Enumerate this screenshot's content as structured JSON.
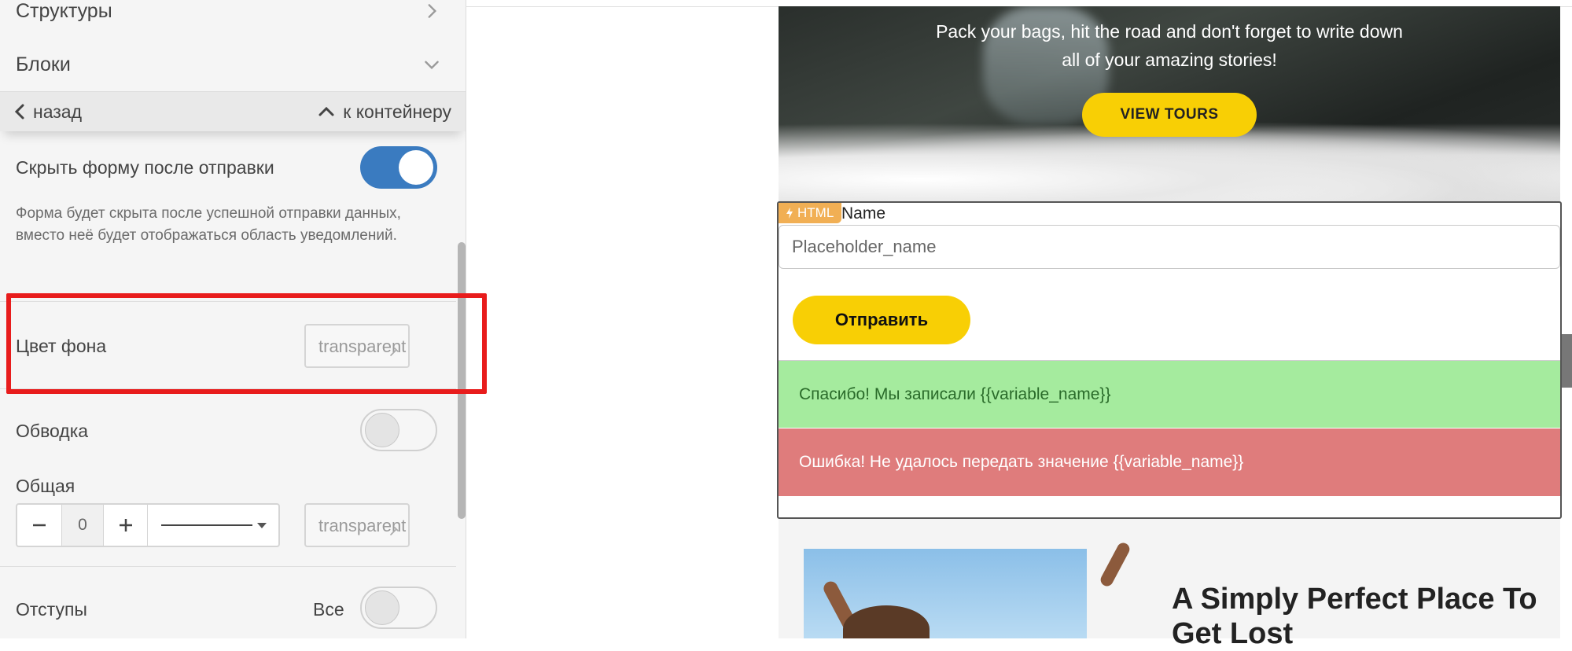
{
  "sidebar": {
    "structures_label": "Структуры",
    "blocks_label": "Блоки",
    "back_label": "назад",
    "container_label": "к контейнеру",
    "hide_form": {
      "label": "Скрыть форму после отправки",
      "enabled": true,
      "hint": "Форма будет скрыта после успешной отправки данных, вместо неё будет отображаться область уведомлений."
    },
    "bg_color": {
      "label": "Цвет фона",
      "value": "transparent"
    },
    "border": {
      "label": "Обводка",
      "enabled": false
    },
    "general": {
      "label": "Общая",
      "width_value": "0",
      "color_value": "transparent"
    },
    "padding": {
      "label": "Отступы",
      "all_label": "Все",
      "enabled": false
    }
  },
  "preview": {
    "hero_text": "Pack your bags, hit the road and don't forget to write down all of your amazing stories!",
    "hero_button": "VIEW TOURS",
    "html_badge": "HTML",
    "field_label": "Name",
    "field_placeholder": "Placeholder_name",
    "submit_label": "Отправить",
    "success_message": "Спасибо! Мы записали {{variable_name}}",
    "error_message": "Ошибка! Не удалось передать значение {{variable_name}}",
    "section_title": "A Simply Perfect Place To Get Lost"
  },
  "colors": {
    "toggle_on": "#3a7bc0",
    "accent_yellow": "#f8cf05",
    "success_bg": "#a5eb9e",
    "error_bg": "#df7c7c",
    "highlight": "#e81c1c"
  }
}
